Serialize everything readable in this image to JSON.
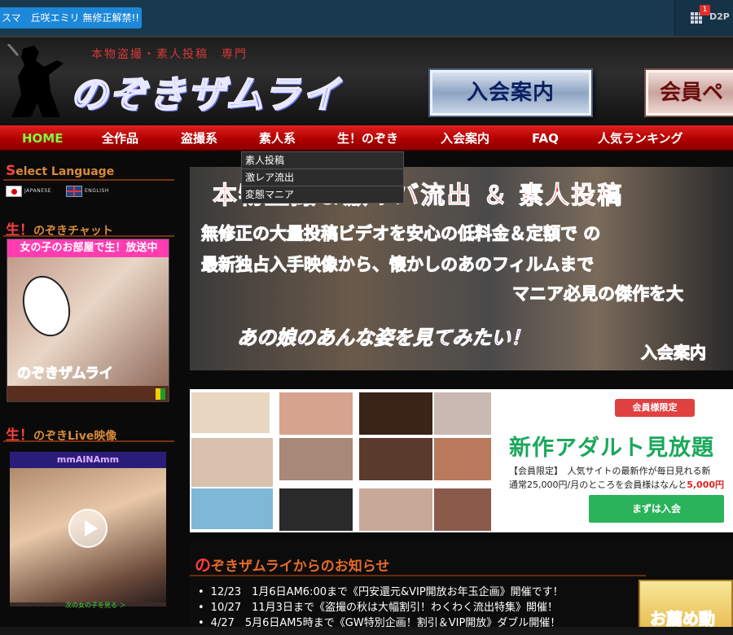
{
  "topbar": {
    "ticker_text": "スマ　丘咲エミリ 無修正解禁!!",
    "widget_badge": "1",
    "widget_label": "D2P"
  },
  "header": {
    "tagline": "本物盗撮・素人投稿　専門",
    "logo_text": "のぞきザムライ",
    "join_button": "入会案内",
    "member_button": "会員ペ"
  },
  "nav": {
    "items": [
      {
        "label": "HOME",
        "active": true
      },
      {
        "label": "全作品"
      },
      {
        "label": "盗撮系"
      },
      {
        "label": "素人系"
      },
      {
        "label": "生！のぞき"
      },
      {
        "label": "入会案内"
      },
      {
        "label": "FAQ"
      },
      {
        "label": "人気ランキング"
      }
    ],
    "dropdown": [
      "素人投稿",
      "激レア流出",
      "変態マニア"
    ]
  },
  "sidebar": {
    "language_heading": "elect Language",
    "language_heading_initial": "S",
    "languages": [
      "JAPANESE",
      "ENGLISH"
    ],
    "chat_heading_initial": "生！",
    "chat_heading": "のぞきチャット",
    "chat_banner": "女の子のお部屋で生！放送中",
    "chat_logo": "のぞきザムライ",
    "live_heading_initial": "生！",
    "live_heading": "のぞきLive映像",
    "live_title": "mmAINAmm",
    "live_footer": "次の女の子を見る ＞"
  },
  "hero": {
    "title": "本物盗撮＆激ヤバ流出 ＆ 素人投稿",
    "line1": "無修正の大量投稿ビデオを安心の低料金＆定額で の",
    "line2": "最新独占入手映像から、懐かしのあのフィルムまで",
    "line3": "マニア必見の傑作を大",
    "cta": "あの娘のあんな姿を見てみたい！",
    "join": "入会案内"
  },
  "promo": {
    "badge": "会員様限定",
    "title": "新作アダルト見放題",
    "subtitle": "【会員限定】　人気サイトの最新作が毎日見れる新",
    "price_prefix": "通常25,000円/月のところを会員様はなんと",
    "price_highlight": "5,000円",
    "button": "まずは入会"
  },
  "news": {
    "title_initial": "の",
    "title": "ぞきザムライからのお知らせ",
    "items": [
      "12/23　1月6日AM6:00まで《円安還元&VIP開放お年玉企画》開催です！",
      "10/27　11月3日まで《盗撮の秋は大幅割引！わくわく流出特集》開催！",
      "4/27　5月6日AM5時まで《GW特別企画！割引＆VIP開放》ダブル開催！"
    ],
    "recommend": "お薦め動"
  }
}
